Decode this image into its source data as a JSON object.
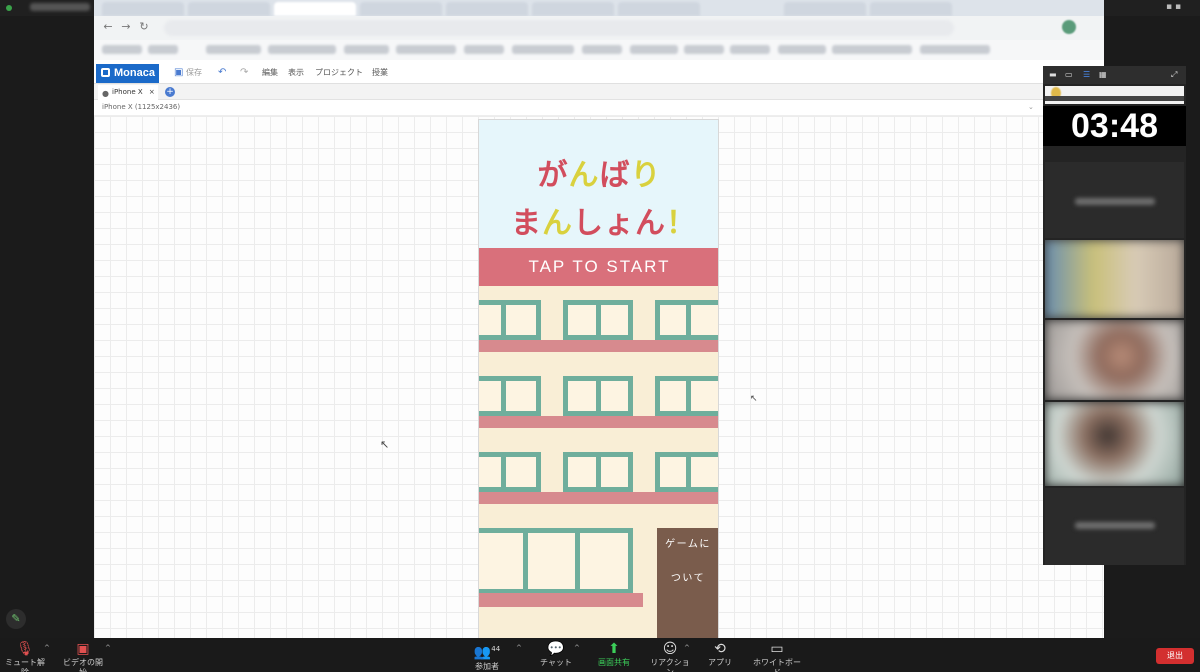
{
  "meeting": {
    "timer": "03:48"
  },
  "monaca": {
    "logo": "Monaca",
    "menu": {
      "save": "保存",
      "edit": "編集",
      "view": "表示",
      "project": "プロジェクト",
      "help": "授業"
    },
    "device_tab": "iPhone X",
    "device_tab_close": "×",
    "device_select": "iPhone X (1125x2436)"
  },
  "game": {
    "title_line1_parts": [
      "が",
      "ん",
      "ば",
      "り"
    ],
    "title_line2_parts": [
      "ま",
      "ん",
      "し",
      "ょ",
      "ん",
      "！"
    ],
    "start_button": "TAP TO START",
    "about_line1": "ゲームに",
    "about_line2": "ついて",
    "colors": {
      "title_pink": "#d24d5d",
      "title_yellow": "#d9d13e",
      "start_bar": "#d9707b",
      "window_frame": "#6fae9c",
      "ledge": "#d78a8e",
      "about_box": "#7a5c4c"
    }
  },
  "zoom_toolbar": {
    "mute": "ミュート解除",
    "video": "ビデオの開始",
    "participants": "参加者",
    "participant_count": "44",
    "chat": "チャット",
    "share": "画面共有",
    "reactions": "リアクション",
    "apps": "アプリ",
    "whiteboard": "ホワイトボード",
    "leave": "退出"
  },
  "icons": {
    "mute": "mic-muted-icon",
    "video": "camera-off-icon",
    "participants": "people-icon",
    "chat": "chat-bubble-icon",
    "share": "share-screen-icon",
    "reactions": "smile-icon",
    "apps": "apps-icon",
    "whiteboard": "whiteboard-icon",
    "pencil": "pencil-icon"
  }
}
